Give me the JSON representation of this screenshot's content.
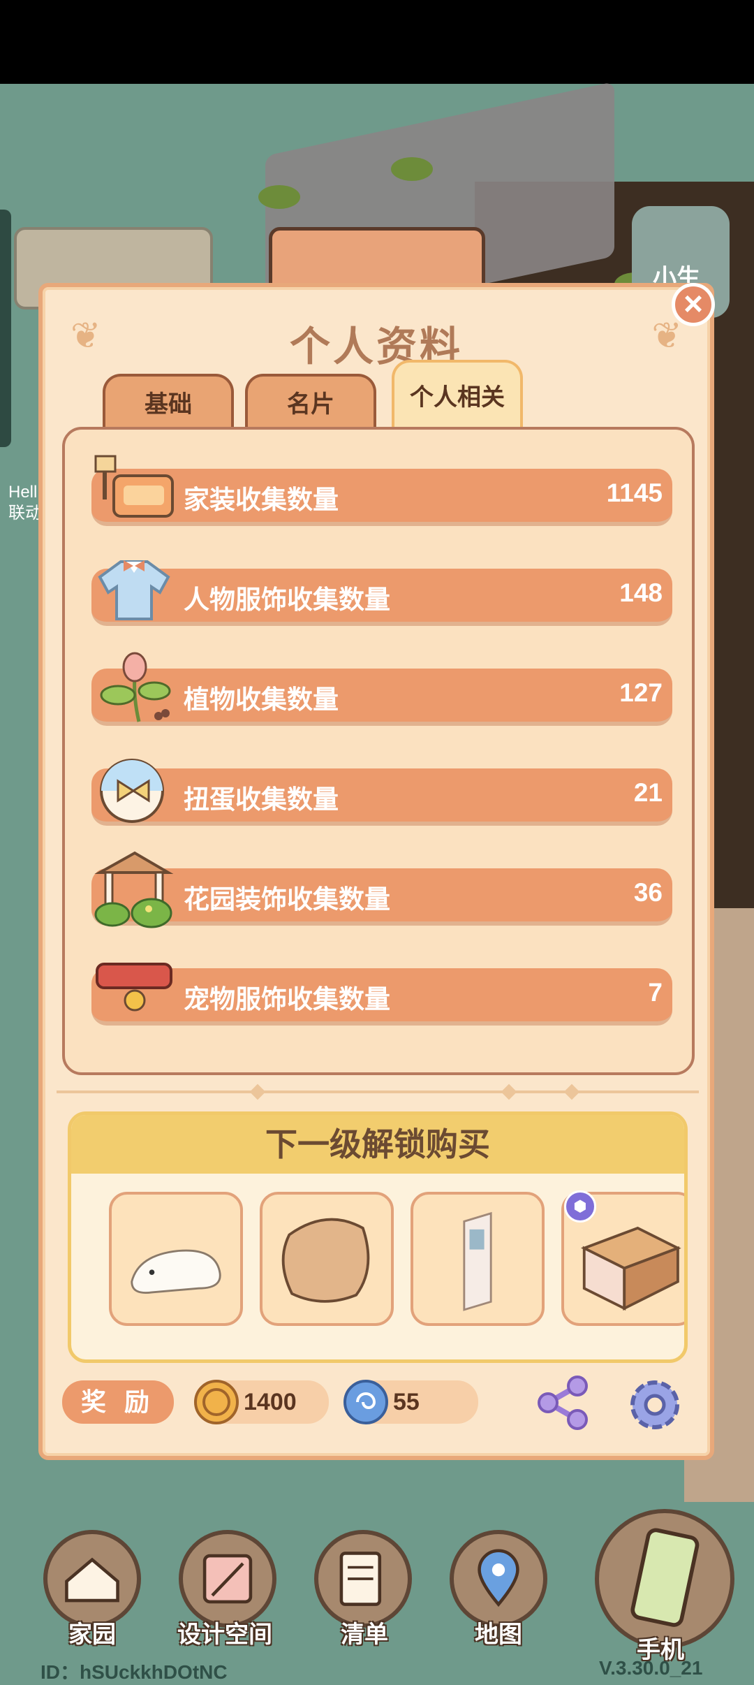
{
  "background": {
    "helper_label": "小生",
    "left_labels": [
      "Hell",
      "联动"
    ]
  },
  "dialog": {
    "title": "个人资料",
    "tabs": [
      {
        "label": "基础",
        "active": false
      },
      {
        "label": "名片",
        "active": false
      },
      {
        "label": "个人相关",
        "active": true
      }
    ],
    "stats": [
      {
        "label": "家装收集数量",
        "value": "1145",
        "icon": "sofa-lamp-icon"
      },
      {
        "label": "人物服饰收集数量",
        "value": "148",
        "icon": "shirt-icon"
      },
      {
        "label": "植物收集数量",
        "value": "127",
        "icon": "flower-sprout-icon"
      },
      {
        "label": "扭蛋收集数量",
        "value": "21",
        "icon": "capsule-toy-icon"
      },
      {
        "label": "花园装饰收集数量",
        "value": "36",
        "icon": "gazebo-icon"
      },
      {
        "label": "宠物服饰收集数量",
        "value": "7",
        "icon": "pet-collar-icon"
      }
    ],
    "unlock": {
      "title": "下一级解锁购买",
      "items": [
        "polar-bear-rug-icon",
        "pillow-icon",
        "door-icon",
        "wood-table-icon"
      ]
    },
    "footer": {
      "reward_label": "奖 励",
      "coin_value": "1400",
      "gem_value": "55"
    }
  },
  "nav": {
    "items": [
      {
        "label": "家园",
        "icon": "home-icon"
      },
      {
        "label": "设计空间",
        "icon": "design-space-icon"
      },
      {
        "label": "清单",
        "icon": "list-icon"
      },
      {
        "label": "地图",
        "icon": "map-pin-icon"
      },
      {
        "label": "手机",
        "icon": "phone-icon"
      }
    ]
  },
  "footer": {
    "id_text": "ID：hSUckkhDOtNC",
    "version": "V.3.30.0_21"
  }
}
